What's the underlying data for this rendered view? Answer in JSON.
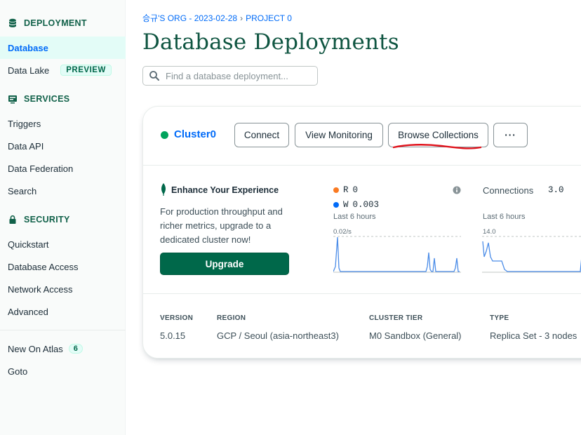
{
  "sidebar": {
    "sections": [
      {
        "label": "DEPLOYMENT",
        "icon": "database-icon"
      },
      {
        "label": "SERVICES",
        "icon": "services-icon"
      },
      {
        "label": "SECURITY",
        "icon": "lock-icon"
      }
    ],
    "deployment_items": [
      {
        "label": "Database",
        "active": true
      },
      {
        "label": "Data Lake",
        "badge": "PREVIEW"
      }
    ],
    "services_items": [
      {
        "label": "Triggers"
      },
      {
        "label": "Data API"
      },
      {
        "label": "Data Federation"
      },
      {
        "label": "Search"
      }
    ],
    "security_items": [
      {
        "label": "Quickstart"
      },
      {
        "label": "Database Access"
      },
      {
        "label": "Network Access"
      },
      {
        "label": "Advanced"
      }
    ],
    "footer_items": [
      {
        "label": "New On Atlas",
        "badge": "6"
      },
      {
        "label": "Goto"
      }
    ]
  },
  "header": {
    "breadcrumb": {
      "org": "승규'S ORG - 2023-02-28",
      "sep": "›",
      "project": "PROJECT 0"
    },
    "title": "Database Deployments",
    "search_placeholder": "Find a database deployment..."
  },
  "cluster": {
    "name": "Cluster0",
    "status_color": "#00a35c",
    "buttons": {
      "connect": "Connect",
      "view_monitoring": "View Monitoring",
      "browse_collections": "Browse Collections",
      "more": "···"
    },
    "promo": {
      "title": "Enhance Your Experience",
      "text": "For production throughput and richer metrics, upgrade to a dedicated cluster now!",
      "cta": "Upgrade"
    },
    "ops_chart": {
      "r_label": "R",
      "r_value": "0",
      "r_color": "#fa7a22",
      "w_label": "W",
      "w_value": "0.003",
      "w_color": "#016bf8",
      "period": "Last 6 hours",
      "max_tick": "0.02/s"
    },
    "connections_chart": {
      "label": "Connections",
      "value": "3.0",
      "period": "Last 6 hours",
      "max_tick": "14.0"
    },
    "meta": {
      "version_label": "VERSION",
      "version": "5.0.15",
      "region_label": "REGION",
      "region": "GCP / Seoul (asia-northeast3)",
      "tier_label": "CLUSTER TIER",
      "tier": "M0 Sandbox (General)",
      "type_label": "TYPE",
      "type": "Replica Set - 3 nodes"
    }
  },
  "colors": {
    "brand_green": "#00684a",
    "link_blue": "#016bf8",
    "chart_blue": "#4c8de8",
    "annotation_red": "#e0121b"
  }
}
